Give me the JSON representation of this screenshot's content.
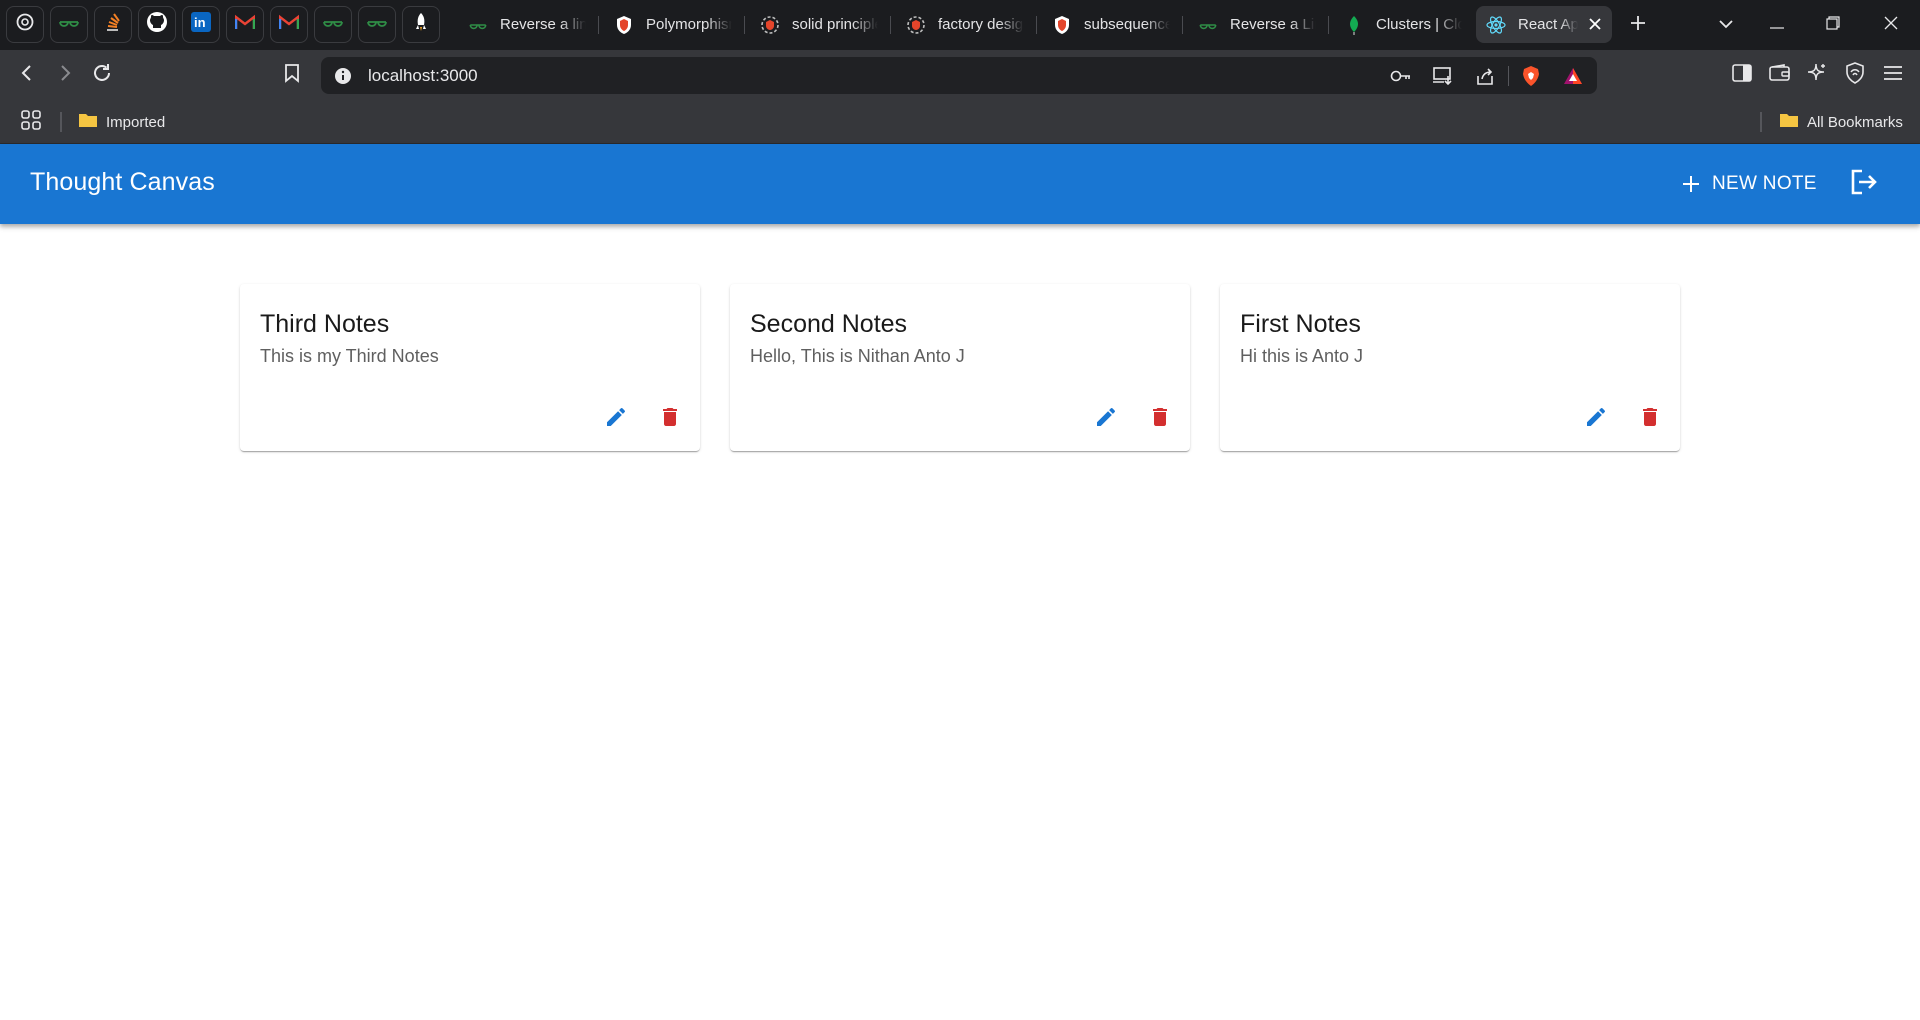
{
  "browser": {
    "pinned_tabs": [
      {
        "icon": "openai-icon"
      },
      {
        "icon": "geeksforgeeks-icon"
      },
      {
        "icon": "stackoverflow-icon"
      },
      {
        "icon": "github-icon"
      },
      {
        "icon": "linkedin-icon"
      },
      {
        "icon": "gmail-icon"
      },
      {
        "icon": "gmail-icon"
      },
      {
        "icon": "geeksforgeeks-icon"
      },
      {
        "icon": "geeksforgeeks-icon"
      },
      {
        "icon": "rocket-icon"
      }
    ],
    "tabs": [
      {
        "title": "Reverse a link",
        "icon": "geeksforgeeks-icon"
      },
      {
        "title": "Polymorphism",
        "icon": "brave-shield-icon"
      },
      {
        "title": "solid principles",
        "icon": "chatgpt-icon"
      },
      {
        "title": "factory design",
        "icon": "chatgpt-icon"
      },
      {
        "title": "subsequence",
        "icon": "brave-shield-icon"
      },
      {
        "title": "Reverse a Link",
        "icon": "geeksforgeeks-icon"
      },
      {
        "title": "Clusters | Cloud",
        "icon": "mongodb-leaf-icon"
      },
      {
        "title": "React App",
        "icon": "react-icon",
        "active": true
      }
    ],
    "address": "localhost:3000",
    "bookmarks": {
      "left": "Imported",
      "right": "All Bookmarks"
    },
    "colors": {
      "tabstrip": "#1b1c1f",
      "toolbar": "#36373b",
      "omnibox": "#202124"
    }
  },
  "app": {
    "title": "Thought Canvas",
    "new_note_label": "NEW NOTE",
    "colors": {
      "primary": "#1976d2",
      "edit": "#1976d2",
      "delete": "#d32f2f"
    },
    "notes": [
      {
        "title": "Third Notes",
        "body": "This is my Third Notes"
      },
      {
        "title": "Second Notes",
        "body": "Hello, This is Nithan Anto J"
      },
      {
        "title": "First Notes",
        "body": "Hi this is Anto J"
      }
    ]
  }
}
